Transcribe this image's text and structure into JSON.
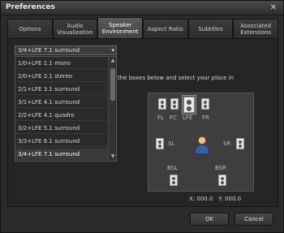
{
  "window": {
    "title": "Preferences",
    "close_glyph": "✕"
  },
  "tabs": [
    {
      "label": "Options",
      "active": false
    },
    {
      "label": "Audio\nVisualization",
      "active": false
    },
    {
      "label": "Speaker\nEnvironment",
      "active": true
    },
    {
      "label": "Aspect Ratio",
      "active": false
    },
    {
      "label": "Subtitles",
      "active": false
    },
    {
      "label": "Associated\nExtensions",
      "active": false
    }
  ],
  "speaker_select": {
    "value": "3/4+LFE 7.1 surround",
    "arrow_glyph": "▾",
    "options": [
      "1/0+LFE 1.1 mono",
      "2/0+LFE 2.1 stereo",
      "2/1+LFE 3.1 surround",
      "3/1+LFE 4.1 surround",
      "2/2+LFE 4.1 quadro",
      "3/2+LFE 5.1 surround",
      "3/3+LFE 6.1 surround",
      "3/4+LFE 7.1 surround"
    ],
    "selected_index": 7
  },
  "scrollbar": {
    "up_glyph": "▲",
    "down_glyph": "▼"
  },
  "instruction_text": "the boxes below and select your place in",
  "channels": {
    "fl": "FL",
    "fc": "FC",
    "lfe": "LFE",
    "fr": "FR",
    "sl": "SL",
    "sr": "SR",
    "bsl": "BSL",
    "bsr": "BSR"
  },
  "coordinates": {
    "x_label": "X:",
    "x_value": "000.0",
    "y_label": "Y:",
    "y_value": "000.0"
  },
  "buttons": {
    "ok": "OK",
    "cancel": "Cancel"
  },
  "icons": {
    "speaker": "speaker-icon",
    "subwoofer": "subwoofer-icon",
    "listener": "listener-icon",
    "close": "close-icon"
  }
}
